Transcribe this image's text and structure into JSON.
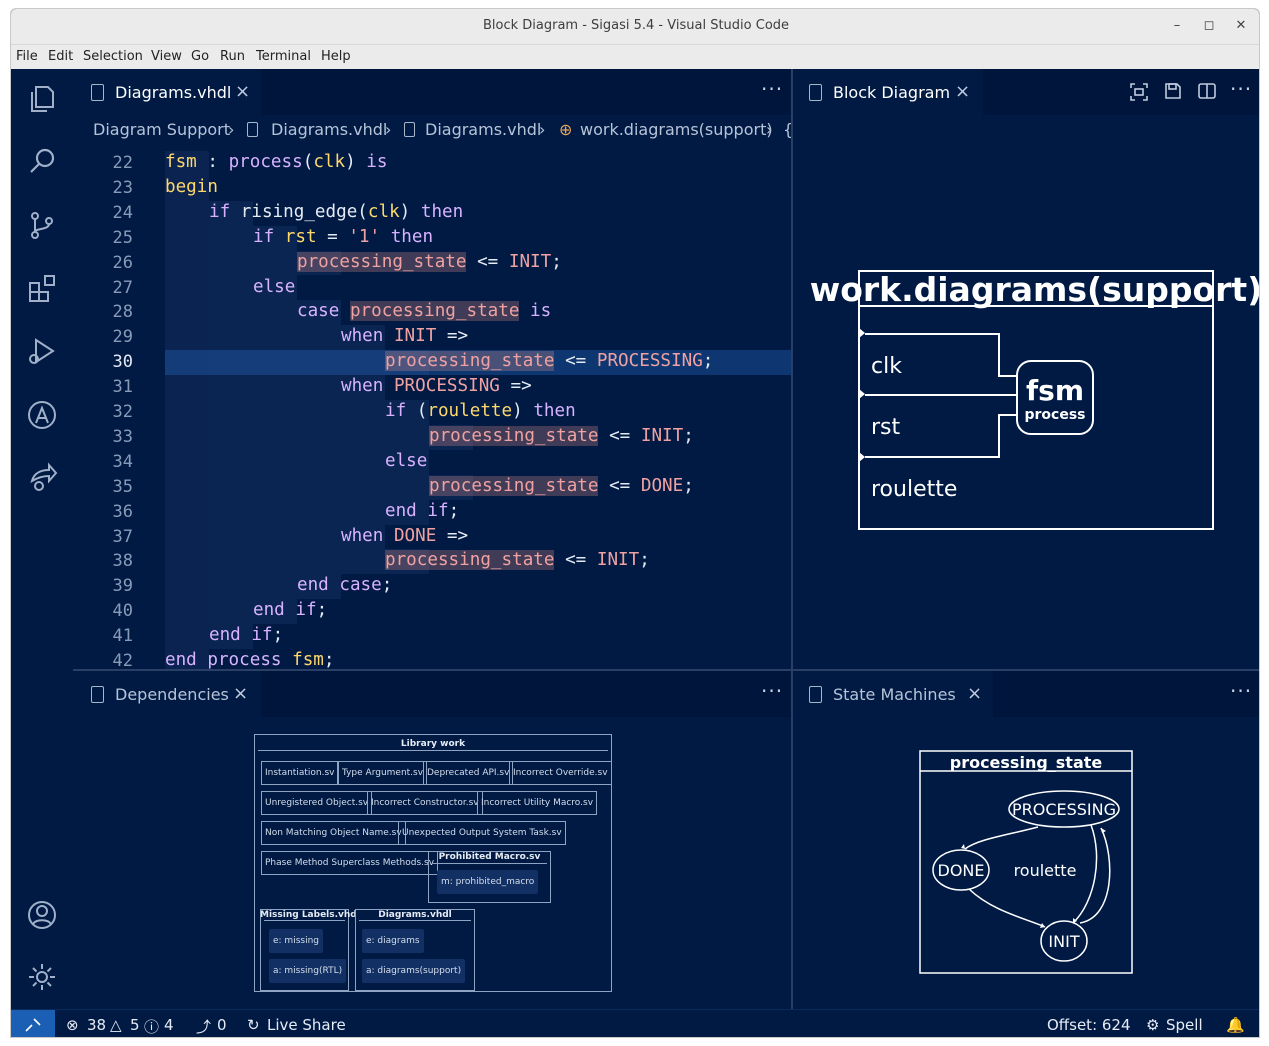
{
  "window": {
    "title": "Block Diagram - Sigasi 5.4 - Visual Studio Code",
    "controls": [
      "minimize-icon",
      "maximize-icon",
      "close-icon"
    ]
  },
  "menu": [
    "File",
    "Edit",
    "Selection",
    "View",
    "Go",
    "Run",
    "Terminal",
    "Help"
  ],
  "activity_bar": {
    "top": [
      "explorer-icon",
      "search-icon",
      "source-control-icon",
      "extensions-icon",
      "run-debug-icon",
      "sigasi-icon",
      "live-share-icon"
    ],
    "bottom": [
      "account-icon",
      "settings-gear-icon"
    ]
  },
  "editor": {
    "tab_label": "Diagrams.vhdl",
    "breadcrumb": [
      "Diagram Support",
      "Diagrams.vhdl",
      "Diagrams.vhdl",
      "work.diagrams(support)",
      "{"
    ],
    "lines": [
      {
        "n": "22",
        "tokens": [
          [
            "fsm",
            "fnm"
          ],
          [
            " : ",
            ""
          ],
          [
            "process",
            "kw2"
          ],
          [
            "(",
            ""
          ],
          [
            "clk",
            "fnm"
          ],
          [
            ") ",
            ""
          ],
          [
            "is",
            "kw2"
          ]
        ],
        "indent": 1
      },
      {
        "n": "23",
        "tokens": [
          [
            "begin",
            "kw"
          ]
        ],
        "indent": 1
      },
      {
        "n": "24",
        "tokens": [
          [
            "if",
            "kw2"
          ],
          [
            " rising_edge",
            ""
          ],
          [
            "(",
            ""
          ],
          [
            "clk",
            "kw"
          ],
          [
            ") ",
            ""
          ],
          [
            "then",
            "kw2"
          ]
        ],
        "indent": 2
      },
      {
        "n": "25",
        "tokens": [
          [
            "if",
            "kw2"
          ],
          [
            " ",
            ""
          ],
          [
            "rst",
            "fnm"
          ],
          [
            " = ",
            ""
          ],
          [
            "'1'",
            "lit"
          ],
          [
            " ",
            ""
          ],
          [
            "then",
            "kw2"
          ]
        ],
        "indent": 3
      },
      {
        "n": "26",
        "tokens": [
          [
            "processing_state",
            "sig"
          ],
          [
            " <= ",
            ""
          ],
          [
            "INIT",
            "id"
          ],
          [
            ";",
            ""
          ]
        ],
        "indent": 4
      },
      {
        "n": "27",
        "tokens": [
          [
            "else",
            "kw2"
          ]
        ],
        "indent": 3
      },
      {
        "n": "28",
        "tokens": [
          [
            "case",
            "kw2"
          ],
          [
            " ",
            ""
          ],
          [
            "processing_state",
            "sig"
          ],
          [
            " ",
            ""
          ],
          [
            "is",
            "kw2"
          ]
        ],
        "indent": 4
      },
      {
        "n": "29",
        "tokens": [
          [
            "when",
            "kw2"
          ],
          [
            " ",
            ""
          ],
          [
            "INIT",
            "id"
          ],
          [
            " =>",
            ""
          ]
        ],
        "indent": 5
      },
      {
        "n": "30",
        "tokens": [
          [
            "processing_state",
            "sig"
          ],
          [
            " <= ",
            ""
          ],
          [
            "PROCESSING",
            "id"
          ],
          [
            ";",
            ""
          ]
        ],
        "indent": 6
      },
      {
        "n": "31",
        "tokens": [
          [
            "when",
            "kw2"
          ],
          [
            " ",
            ""
          ],
          [
            "PROCESSING",
            "id"
          ],
          [
            " =>",
            ""
          ]
        ],
        "indent": 5
      },
      {
        "n": "32",
        "tokens": [
          [
            "if",
            "kw2"
          ],
          [
            " (",
            ""
          ],
          [
            "roulette",
            "fnm"
          ],
          [
            ") ",
            ""
          ],
          [
            "then",
            "kw2"
          ]
        ],
        "indent": 6
      },
      {
        "n": "33",
        "tokens": [
          [
            "processing_state",
            "sig"
          ],
          [
            " <= ",
            ""
          ],
          [
            "INIT",
            "id"
          ],
          [
            ";",
            ""
          ]
        ],
        "indent": 7
      },
      {
        "n": "34",
        "tokens": [
          [
            "else",
            "kw2"
          ]
        ],
        "indent": 6
      },
      {
        "n": "35",
        "tokens": [
          [
            "processing_state",
            "sig"
          ],
          [
            " <= ",
            ""
          ],
          [
            "DONE",
            "id"
          ],
          [
            ";",
            ""
          ]
        ],
        "indent": 7
      },
      {
        "n": "36",
        "tokens": [
          [
            "end",
            "kw2"
          ],
          [
            " ",
            ""
          ],
          [
            "if",
            "kw2"
          ],
          [
            ";",
            ""
          ]
        ],
        "indent": 6
      },
      {
        "n": "37",
        "tokens": [
          [
            "when",
            "kw2"
          ],
          [
            " ",
            ""
          ],
          [
            "DONE",
            "id"
          ],
          [
            " =>",
            ""
          ]
        ],
        "indent": 5
      },
      {
        "n": "38",
        "tokens": [
          [
            "processing_state",
            "sig"
          ],
          [
            " <= ",
            ""
          ],
          [
            "INIT",
            "id"
          ],
          [
            ";",
            ""
          ]
        ],
        "indent": 6
      },
      {
        "n": "39",
        "tokens": [
          [
            "end",
            "kw2"
          ],
          [
            " ",
            ""
          ],
          [
            "case",
            "kw2"
          ],
          [
            ";",
            ""
          ]
        ],
        "indent": 4
      },
      {
        "n": "40",
        "tokens": [
          [
            "end",
            "kw2"
          ],
          [
            " ",
            ""
          ],
          [
            "if",
            "kw2"
          ],
          [
            ";",
            ""
          ]
        ],
        "indent": 3
      },
      {
        "n": "41",
        "tokens": [
          [
            "end",
            "kw2"
          ],
          [
            " ",
            ""
          ],
          [
            "if",
            "kw2"
          ],
          [
            ";",
            ""
          ]
        ],
        "indent": 2
      },
      {
        "n": "42",
        "tokens": [
          [
            "end",
            "kw2"
          ],
          [
            " ",
            ""
          ],
          [
            "process",
            "kw2"
          ],
          [
            " ",
            ""
          ],
          [
            "fsm",
            "fnm"
          ],
          [
            ";",
            ""
          ]
        ],
        "indent": 1
      }
    ],
    "current_line": "30"
  },
  "block_diagram": {
    "tab_label": "Block Diagram",
    "entity": "work.diagrams(support)",
    "ports": [
      "clk",
      "rst",
      "roulette"
    ],
    "process_name": "fsm",
    "process_label": "process",
    "toolbar": [
      "fit-to-screen-icon",
      "save-icon",
      "split-editor-icon"
    ]
  },
  "dependencies": {
    "tab_label": "Dependencies",
    "library": "Library work",
    "rows": [
      [
        "Instantiation.sv",
        "Type Argument.sv",
        "Deprecated API.sv",
        "Incorrect Override.sv"
      ],
      [
        "Unregistered Object.sv",
        "Incorrect Constructor.sv",
        "Incorrect Utility Macro.sv"
      ],
      [
        "Non Matching Object Name.sv",
        "Unexpected Output System Task.sv"
      ],
      [
        "Phase Method Superclass Methods.sv"
      ]
    ],
    "prohibited": {
      "title": "Prohibited Macro.sv",
      "items": [
        "m: prohibited_macro"
      ]
    },
    "missing": {
      "title": "Missing Labels.vhd",
      "items": [
        "e: missing",
        "a: missing(RTL)"
      ]
    },
    "diagrams": {
      "title": "Diagrams.vhdl",
      "items": [
        "e: diagrams",
        "a: diagrams(support)"
      ]
    }
  },
  "state_machines": {
    "tab_label": "State Machines",
    "name": "processing_state",
    "states": [
      "PROCESSING",
      "DONE",
      "INIT"
    ],
    "condition": "roulette"
  },
  "status_bar": {
    "errors": "38",
    "warnings": "5",
    "infos": "4",
    "ports": "0",
    "live_share": "Live Share",
    "offset": "Offset: 624",
    "spell": "Spell"
  }
}
